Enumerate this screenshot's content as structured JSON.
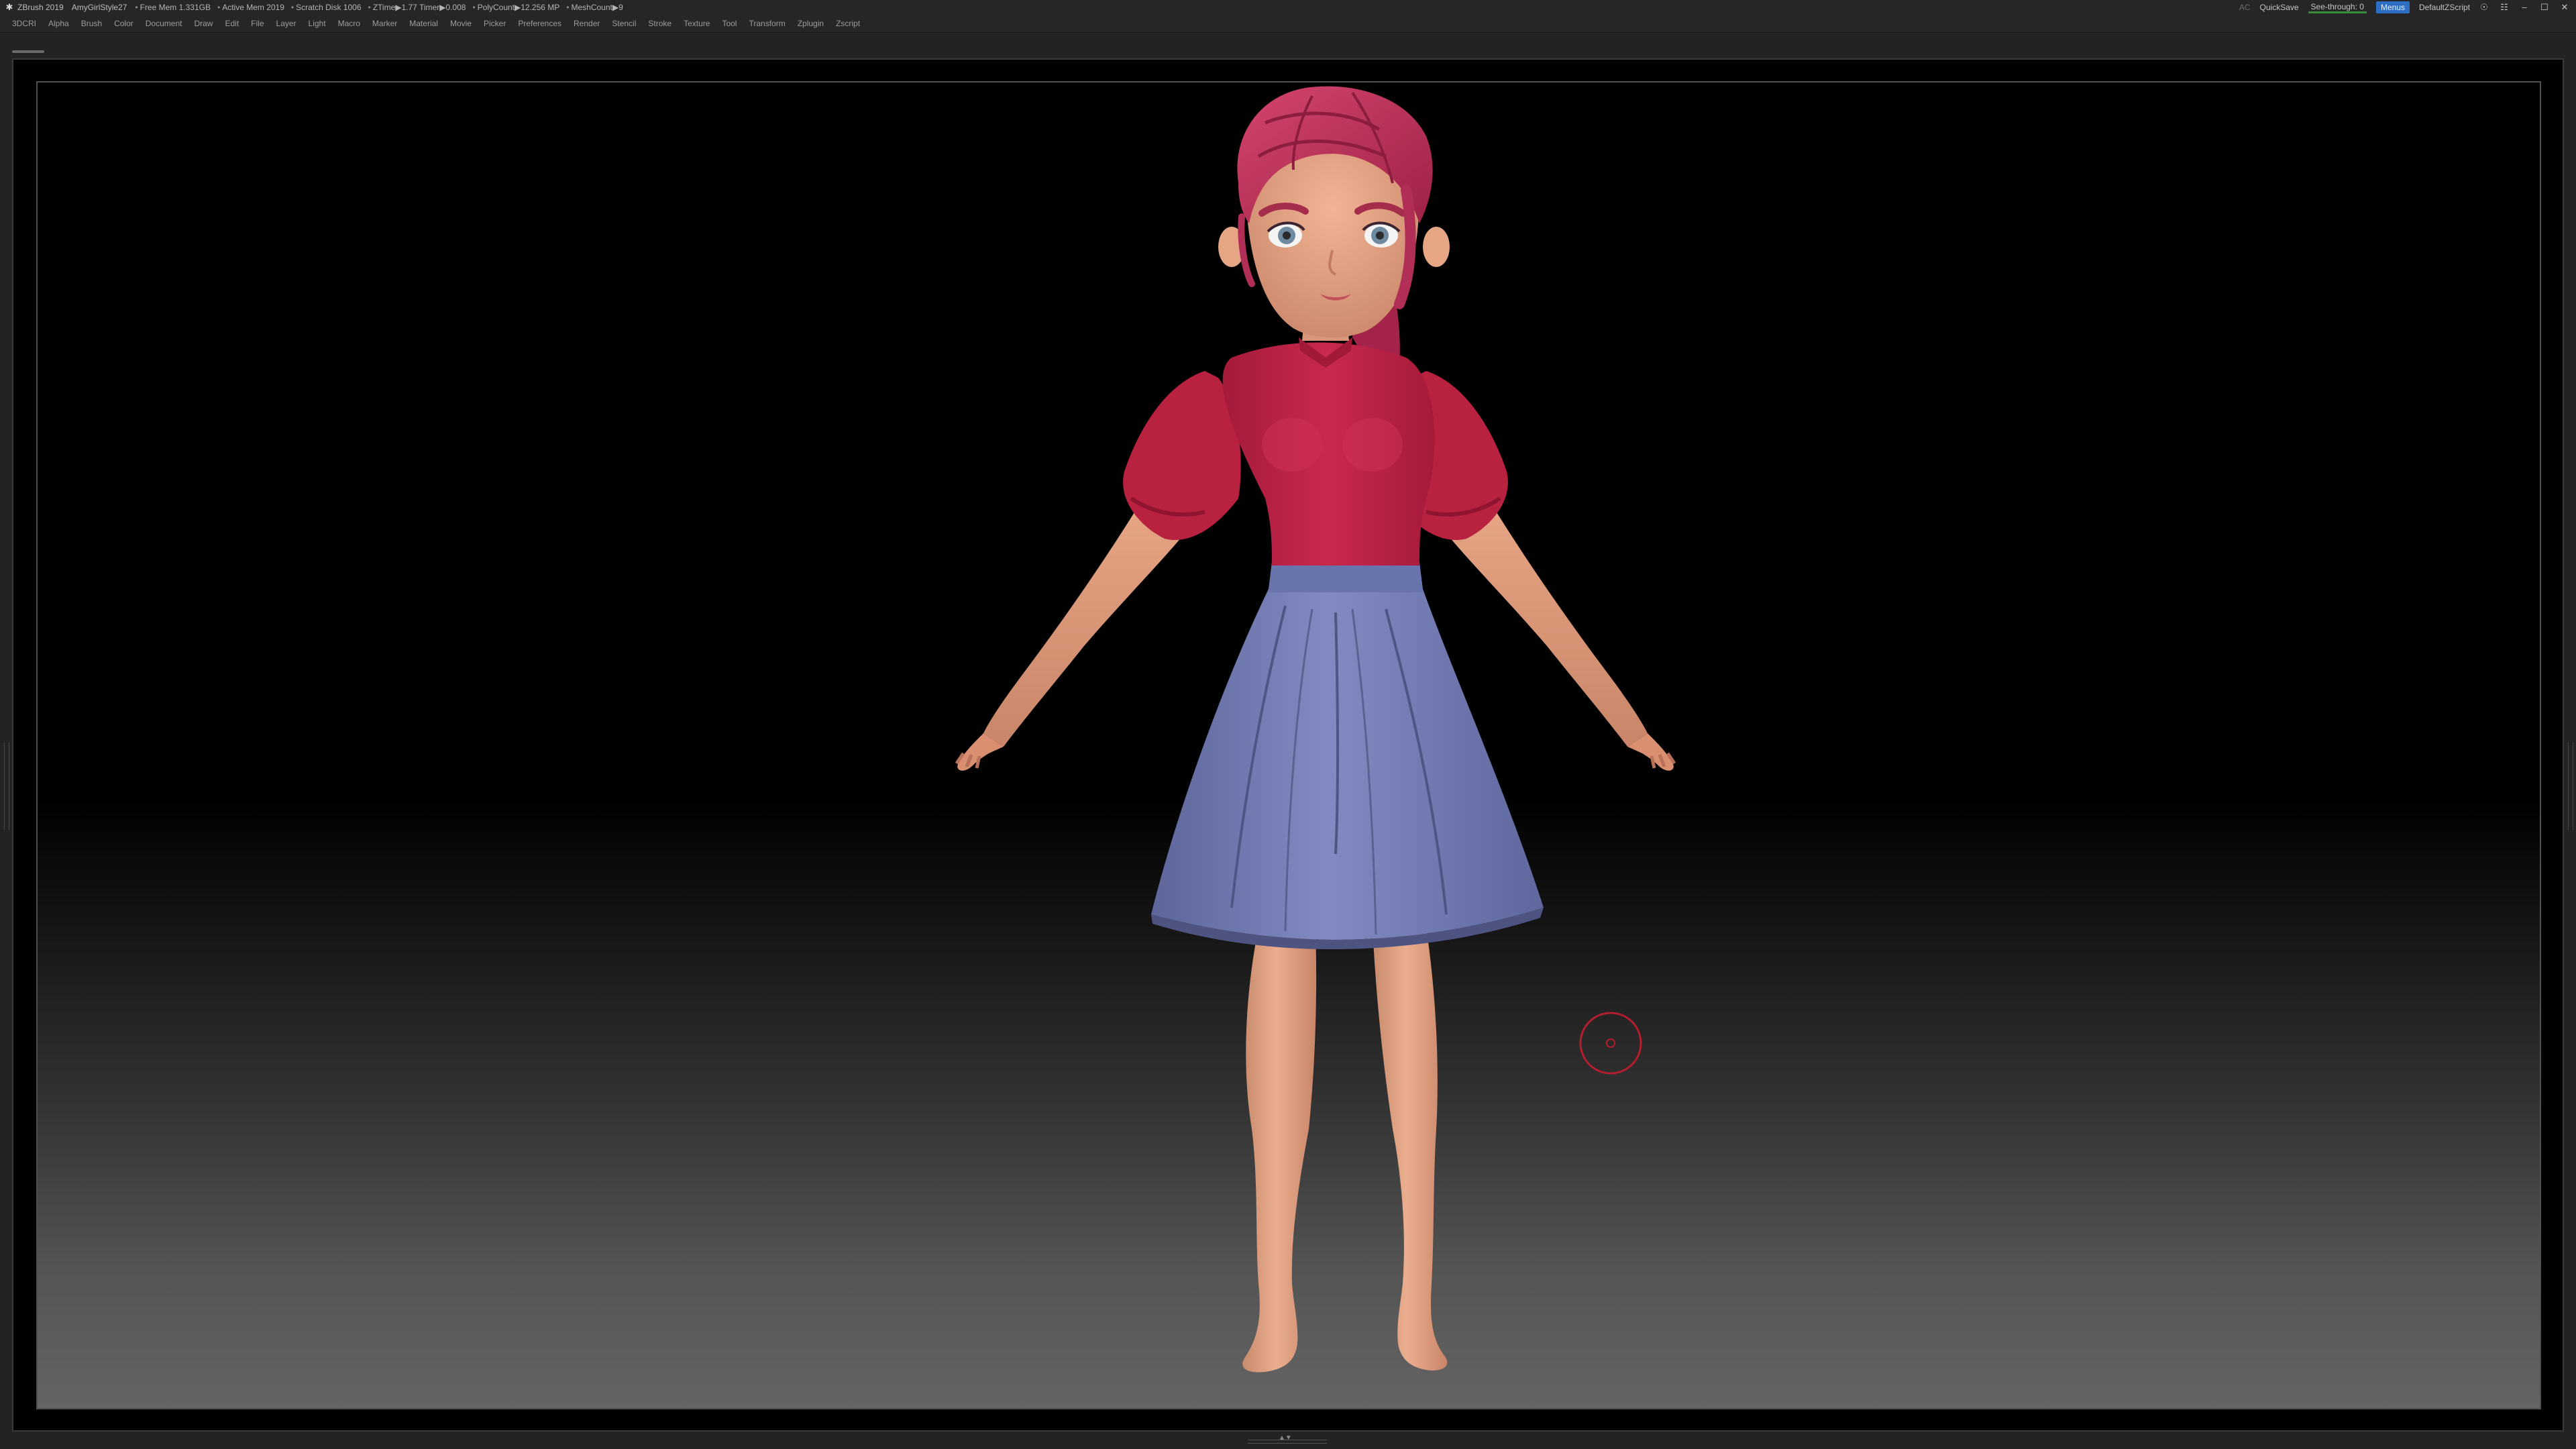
{
  "titlebar": {
    "app_name": "ZBrush 2019",
    "project": "AmyGirlStyle27",
    "stats": [
      "Free Mem 1.331GB",
      "Active Mem 2019",
      "Scratch Disk 1006",
      "ZTime▶1.77 Timer▶0.008",
      "PolyCount▶12.256 MP",
      "MeshCount▶9"
    ],
    "ac": "AC",
    "quicksave": "QuickSave",
    "see_through": "See-through: 0",
    "menus": "Menus",
    "default_zscript": "DefaultZScript",
    "icons": [
      "help-icon",
      "layout-icon",
      "minimize-icon",
      "maximize-icon",
      "close-icon"
    ]
  },
  "menubar": {
    "items": [
      "3DCRI",
      "Alpha",
      "Brush",
      "Color",
      "Document",
      "Draw",
      "Edit",
      "File",
      "Layer",
      "Light",
      "Macro",
      "Marker",
      "Material",
      "Movie",
      "Picker",
      "Preferences",
      "Render",
      "Stencil",
      "Stroke",
      "Texture",
      "Tool",
      "Transform",
      "Zplugin",
      "Zscript"
    ]
  },
  "viewport": {
    "subject": "3D character",
    "colors": {
      "hair": "#c8365f",
      "skin": "#e9a887",
      "top": "#c22448",
      "skirt": "#7681b8",
      "brush_cursor": "#b21e2e"
    }
  }
}
